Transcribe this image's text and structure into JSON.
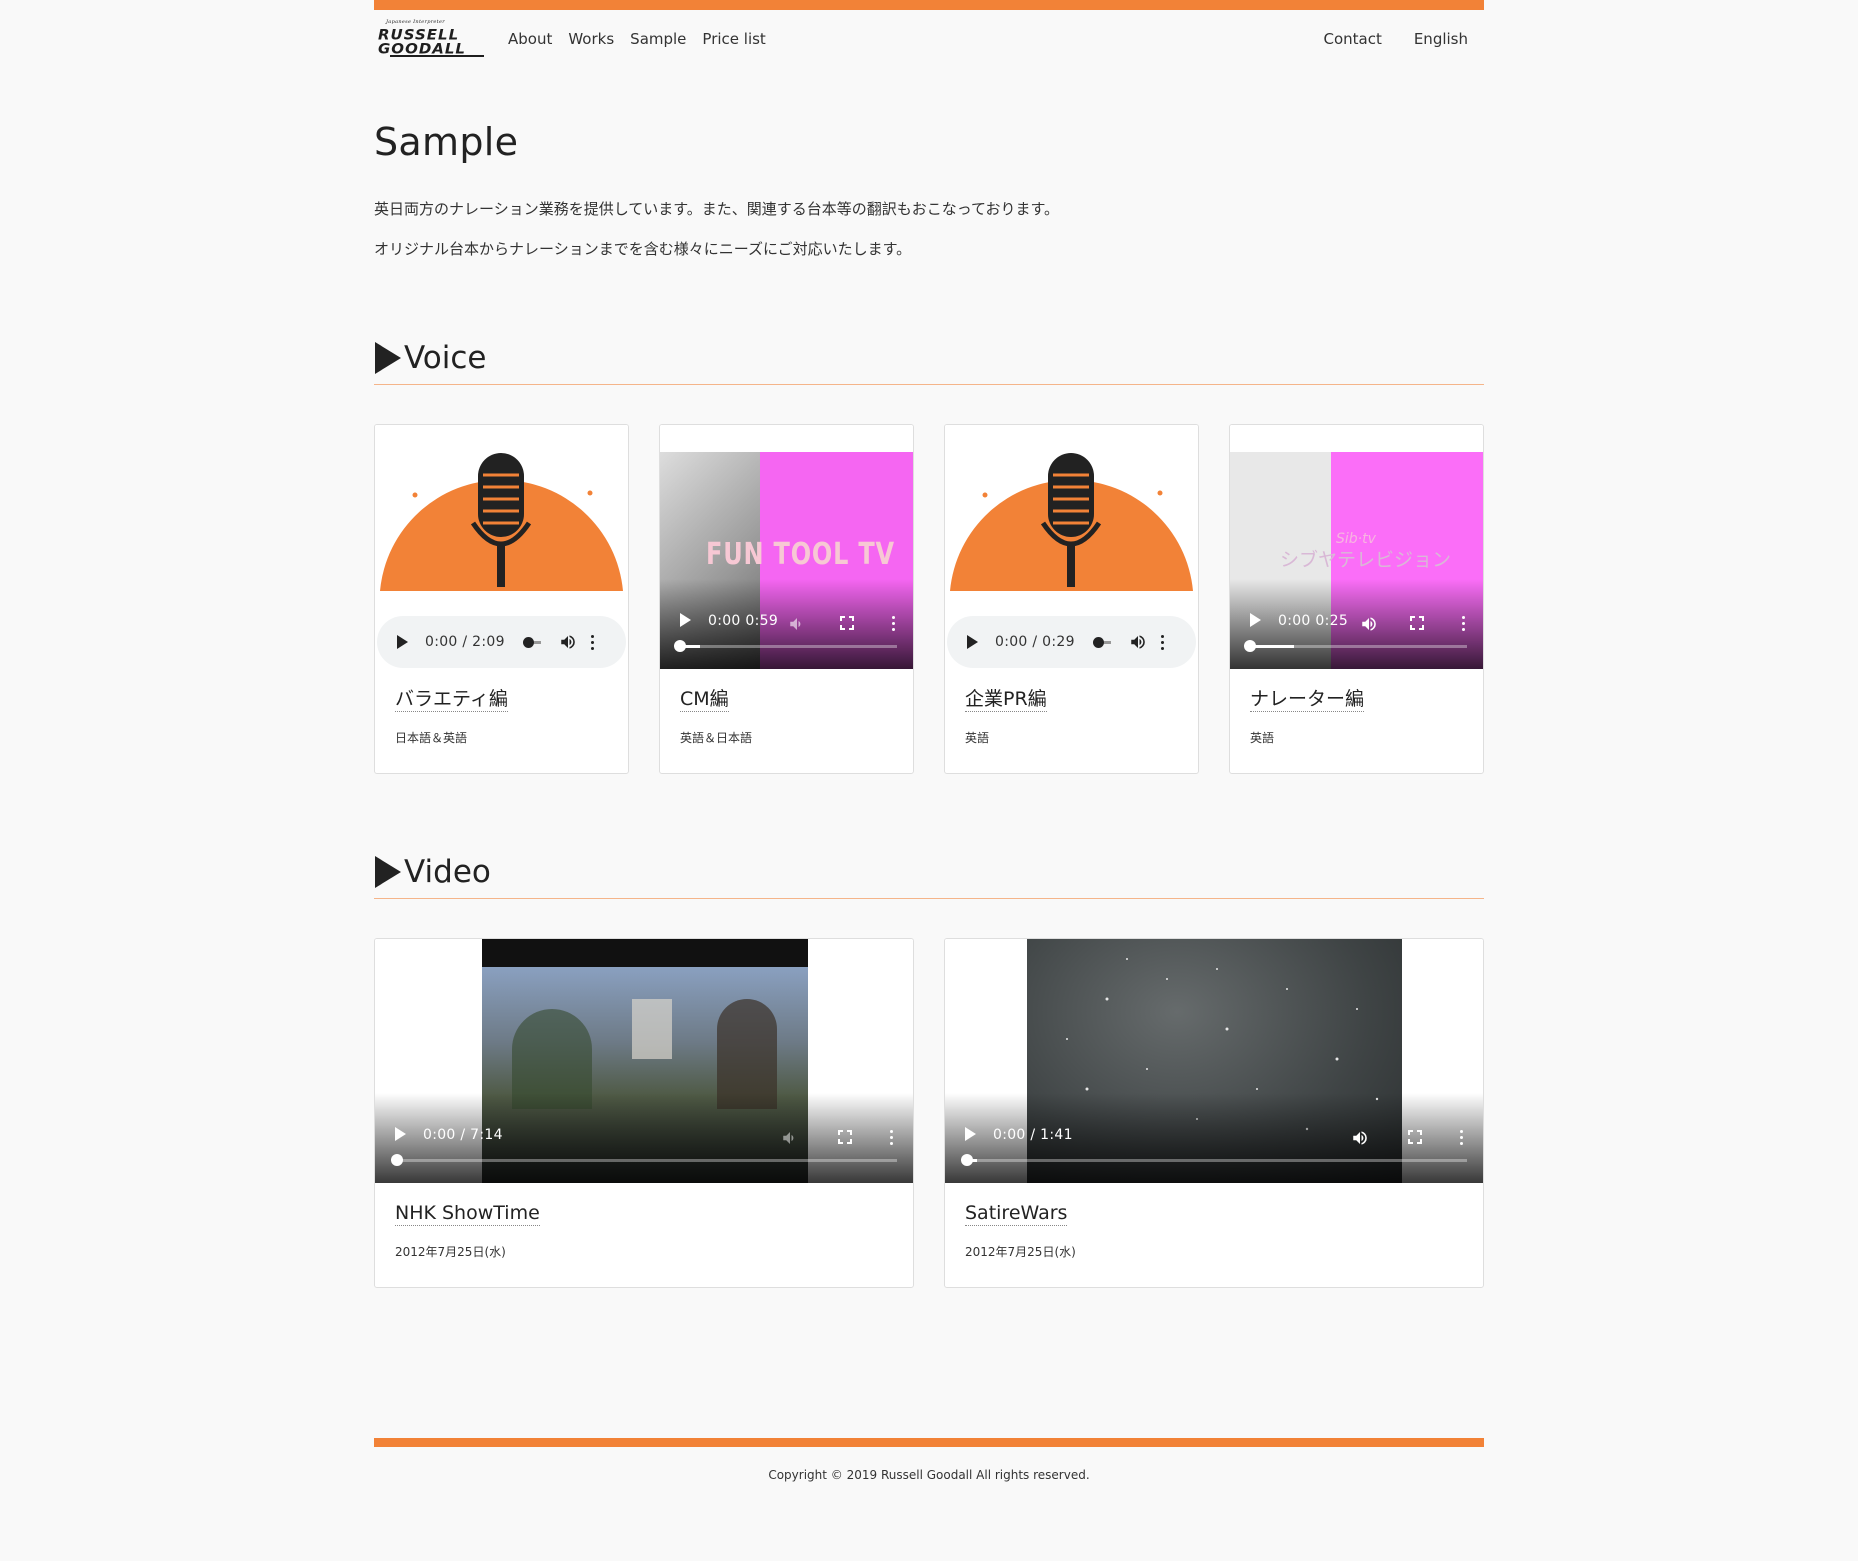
{
  "logo": {
    "subtitle": "Japanese Interpreter",
    "line1": "RUSSELL",
    "line2": "GOODALL"
  },
  "nav": {
    "items": [
      "About",
      "Works",
      "Sample",
      "Price list"
    ],
    "right": [
      "Contact",
      "English"
    ]
  },
  "page": {
    "title": "Sample",
    "intro1": "英日両方のナレーション業務を提供しています。また、関連する台本等の翻訳もおこなっております。",
    "intro2": "オリジナル台本からナレーションまでを含む様々にニーズにご対応いたします。"
  },
  "voice": {
    "heading": "Voice",
    "cards": [
      {
        "title": "バラエティ編",
        "sub": "日本語＆英語",
        "time": "0:00 / 2:09",
        "kind": "audio"
      },
      {
        "title": "CM編",
        "sub": "英語＆日本語",
        "time": "0:00 0:59",
        "kind": "video",
        "thumb_text": "FUN TOOL TV"
      },
      {
        "title": "企業PR編",
        "sub": "英語",
        "time": "0:00 / 0:29",
        "kind": "audio"
      },
      {
        "title": "ナレーター編",
        "sub": "英語",
        "time": "0:00 0:25",
        "kind": "video",
        "thumb_text": "シブヤテレビジョン",
        "thumb_text2": "Sib·tv"
      }
    ]
  },
  "video": {
    "heading": "Video",
    "cards": [
      {
        "title": "NHK ShowTime",
        "sub": "2012年7月25日(水)",
        "time": "0:00 / 7:14"
      },
      {
        "title": "SatireWars",
        "sub": "2012年7月25日(水)",
        "time": "0:00 / 1:41"
      }
    ]
  },
  "footer": {
    "copyright": "Copyright © 2019 Russell Goodall All rights reserved."
  },
  "colors": {
    "accent": "#f28237",
    "background": "#f9f9f9"
  }
}
